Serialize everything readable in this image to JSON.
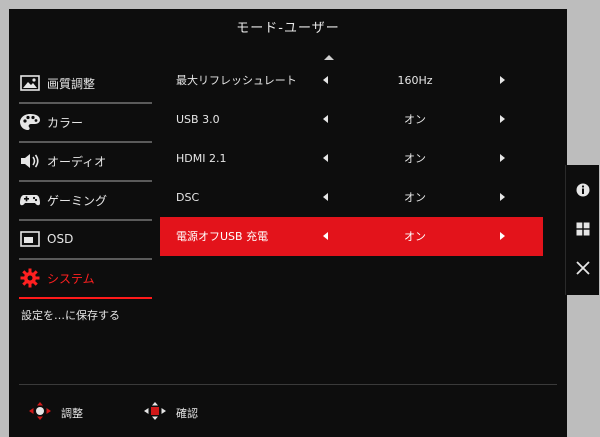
{
  "title": "モード-ユーザー",
  "sidebar": {
    "items": [
      {
        "label": "画質調整",
        "icon": "picture-icon"
      },
      {
        "label": "カラー",
        "icon": "palette-icon"
      },
      {
        "label": "オーディオ",
        "icon": "speaker-icon"
      },
      {
        "label": "ゲーミング",
        "icon": "gamepad-icon"
      },
      {
        "label": "OSD",
        "icon": "osd-icon"
      },
      {
        "label": "システム",
        "icon": "gear-icon"
      }
    ],
    "save_label": "設定を…に保存する"
  },
  "settings": [
    {
      "label": "最大リフレッシュレート",
      "value": "160Hz"
    },
    {
      "label": "USB 3.0",
      "value": "オン"
    },
    {
      "label": "HDMI 2.1",
      "value": "オン"
    },
    {
      "label": "DSC",
      "value": "オン"
    },
    {
      "label": "電源オフUSB 充電",
      "value": "オン"
    }
  ],
  "footer": {
    "adjust_label": "調整",
    "confirm_label": "確認"
  },
  "side_panel": [
    "info-icon",
    "input-source-icon",
    "close-icon"
  ],
  "colors": {
    "accent": "#e3131b",
    "background": "#0d0d0d"
  }
}
